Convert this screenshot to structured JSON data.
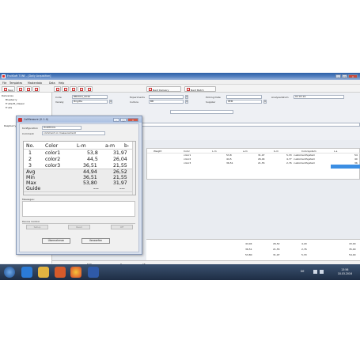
{
  "window": {
    "title": "FruitSoft TONE - [Daily Acquisition]",
    "min": "–",
    "max": "□",
    "close": "×"
  },
  "menu": [
    "File",
    "Templates",
    "Masterdata",
    "Data",
    "Help"
  ],
  "toolbar": {
    "new_label": "New",
    "next_delivery": "Next Delivery",
    "next_batch": "Next Batch"
  },
  "tree": {
    "items": [
      "Deliveries",
      "Blueberry",
      "Fruitsoft_Classic",
      "Fruits",
      "Raspberry"
    ]
  },
  "form": {
    "code_label": "Code",
    "code_value": "BB2016_0040",
    "variety_label": "Variety",
    "variety_value": "Brigitta",
    "experiments_label": "Experiments",
    "culture_label": "Culture",
    "culture_value": "BB",
    "picking_date_label": "Picking Date",
    "picking_date_value": "",
    "supplier_label": "Supplier",
    "supplier_value": "PEM",
    "analysis_date_label": "Analysedatum",
    "analysis_date_value": "02.03.16"
  },
  "grid": {
    "headers": [
      "Weight",
      "Color",
      "L-m",
      "a-m",
      "b-m",
      "Colorsystem",
      "L-s"
    ],
    "rows": [
      [
        "",
        "color1",
        "53,8",
        "31,97",
        "5,33",
        "customerdSystem",
        "54"
      ],
      [
        "",
        "color2",
        "44,5",
        "26,04",
        "4,77",
        "customerdSystem",
        "40"
      ],
      [
        "",
        "color3",
        "36,51",
        "21,55",
        "2,76",
        "customerdSystem",
        "36"
      ]
    ]
  },
  "summary": {
    "rows": [
      [
        "44,94",
        "26,52",
        "4,29",
        "43,00"
      ],
      [
        "36,51",
        "21,55",
        "2,76",
        "35,00"
      ],
      [
        "53,80",
        "31,97",
        "5,33",
        "54,00"
      ]
    ],
    "bottom": [
      "500",
      "0",
      "15"
    ]
  },
  "dialog": {
    "title": "ColMeasure (V. 1.0)",
    "min": "–",
    "max": "□",
    "close": "×",
    "config_label": "Konfiguration",
    "config_value": "HORTICOL",
    "comment_label": "Comment",
    "comment_value": "comment on measurement",
    "table_headers": [
      "No.",
      "Color",
      "L-m",
      "a-m",
      "b-"
    ],
    "rows": [
      [
        "1",
        "color1",
        "53,8",
        "31,97"
      ],
      [
        "2",
        "color2",
        "44,5",
        "26,04"
      ],
      [
        "3",
        "color3",
        "36,51",
        "21,55"
      ]
    ],
    "summary_rows": [
      [
        "Avg",
        "44,94",
        "26,52"
      ],
      [
        "Min",
        "36,51",
        "21,55"
      ],
      [
        "Max",
        "53,80",
        "31,97"
      ],
      [
        "Guide",
        "---",
        "---"
      ]
    ],
    "messages_label": "Messages:",
    "device_control_label": "Device Control",
    "setup_label": "Setup",
    "read_label": "Read",
    "off_label": "Off",
    "accept_label": "Übernehmen",
    "cancel_label": "Verwerfen"
  },
  "taskbar": {
    "lang": "DE",
    "time": "13:56",
    "date": "18.03.2016"
  },
  "colors": {
    "title_blue": "#2b5fa6",
    "accent_selected": "#3b8ee3",
    "taskbar": "#1e2d44"
  }
}
